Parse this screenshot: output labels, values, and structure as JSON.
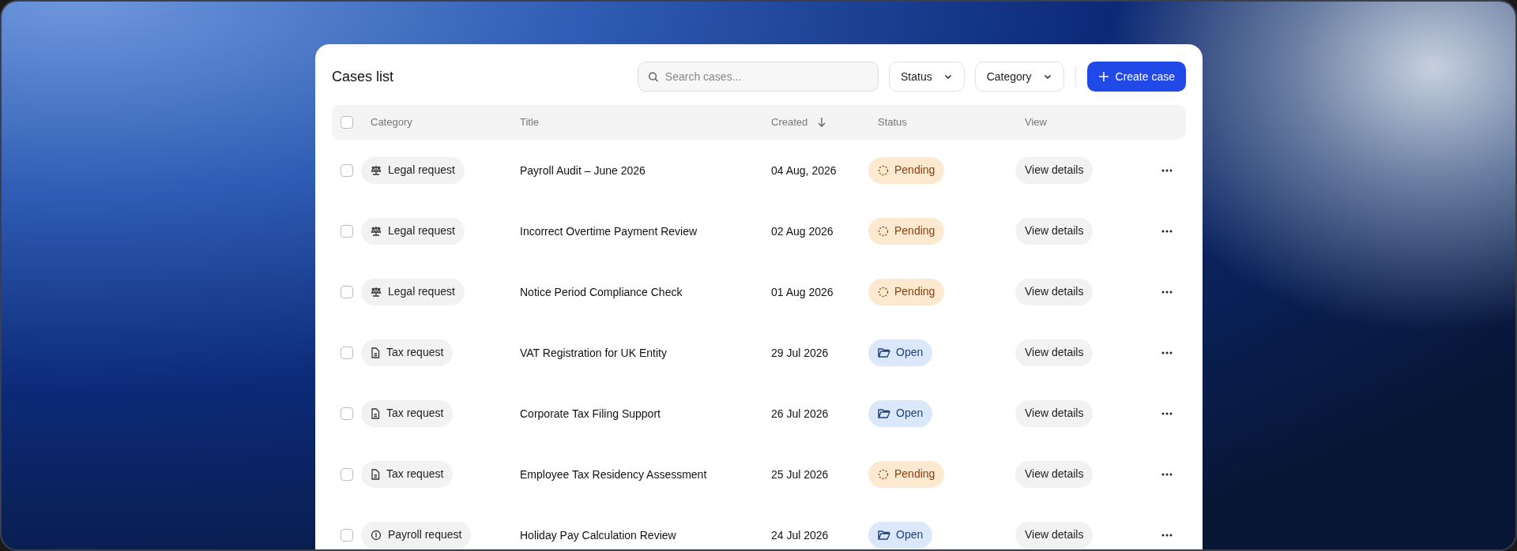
{
  "title": "Cases list",
  "search": {
    "placeholder": "Search cases..."
  },
  "filters": [
    "Status",
    "Category"
  ],
  "create_button": "Create case",
  "table": {
    "select_all": {
      "checked": false
    },
    "columns": [
      "Category",
      "Title",
      "Created",
      "Status",
      "View"
    ],
    "rows": [
      {
        "checked": false,
        "category": {
          "label": "Legal request",
          "kind": "legal"
        },
        "title": "Payroll Audit – June 2026",
        "created": "04 Aug, 2026",
        "status": {
          "label": "Pending",
          "kind": "pending"
        },
        "view": "View details"
      },
      {
        "checked": false,
        "category": {
          "label": "Legal request",
          "kind": "legal"
        },
        "title": "Incorrect Overtime Payment Review",
        "created": "02 Aug 2026",
        "status": {
          "label": "Pending",
          "kind": "pending"
        },
        "view": "View details"
      },
      {
        "checked": false,
        "category": {
          "label": "Legal request",
          "kind": "legal"
        },
        "title": "Notice Period Compliance Check",
        "created": "01 Aug 2026",
        "status": {
          "label": "Pending",
          "kind": "pending"
        },
        "view": "View details"
      },
      {
        "checked": false,
        "category": {
          "label": "Tax request",
          "kind": "tax"
        },
        "title": "VAT Registration for UK Entity",
        "created": "29 Jul 2026",
        "status": {
          "label": "Open",
          "kind": "open"
        },
        "view": "View details"
      },
      {
        "checked": false,
        "category": {
          "label": "Tax request",
          "kind": "tax"
        },
        "title": "Corporate Tax Filing Support",
        "created": "26 Jul 2026",
        "status": {
          "label": "Open",
          "kind": "open"
        },
        "view": "View details"
      },
      {
        "checked": false,
        "category": {
          "label": "Tax request",
          "kind": "tax"
        },
        "title": "Employee Tax Residency Assessment",
        "created": "25 Jul 2026",
        "status": {
          "label": "Pending",
          "kind": "pending"
        },
        "view": "View details"
      },
      {
        "checked": false,
        "category": {
          "label": "Payroll request",
          "kind": "payroll"
        },
        "title": "Holiday Pay Calculation Review",
        "created": "24 Jul 2026",
        "status": {
          "label": "Open",
          "kind": "open"
        },
        "view": "View details"
      }
    ]
  }
}
